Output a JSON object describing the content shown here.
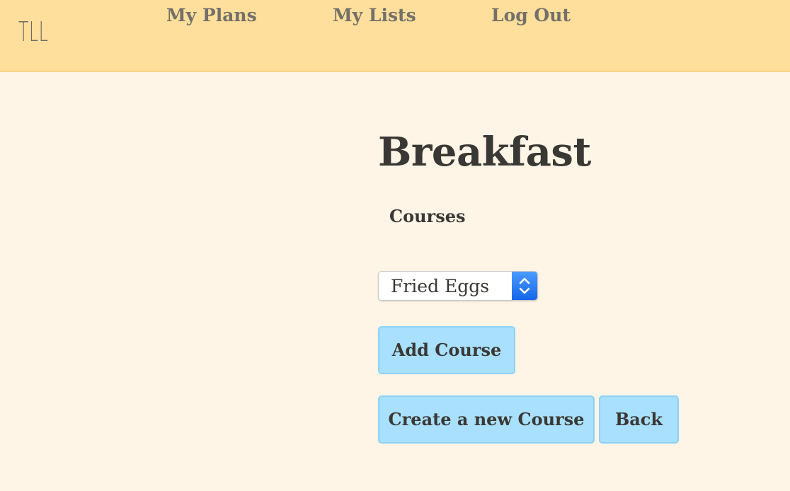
{
  "app": {
    "logo": "TLL"
  },
  "nav": {
    "items": [
      {
        "label": "My Plans"
      },
      {
        "label": "My Lists"
      },
      {
        "label": "Log Out"
      }
    ]
  },
  "page": {
    "title": "Breakfast",
    "section_label": "Courses"
  },
  "course_select": {
    "selected": "Fried Eggs",
    "icon": "chevron-up-down-icon"
  },
  "buttons": {
    "add_course": "Add Course",
    "create_course": "Create a new Course",
    "back": "Back"
  },
  "colors": {
    "navbar_bg": "#ffdf9b",
    "page_bg": "#fef5e7",
    "button_bg": "#a8e0fd",
    "text": "#3a3834",
    "nav_text": "#737069",
    "select_accent": "#1f74f0"
  }
}
